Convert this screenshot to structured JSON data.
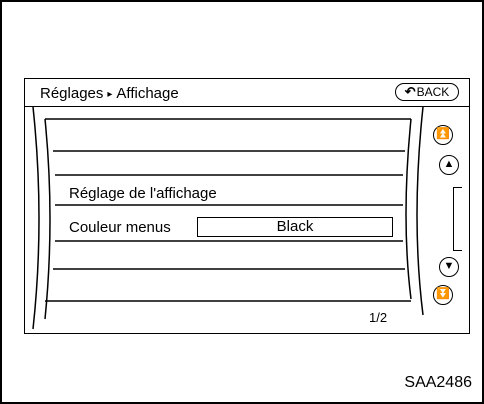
{
  "header": {
    "breadcrumb_parent": "Réglages",
    "breadcrumb_separator": "▸",
    "breadcrumb_current": "Affichage",
    "back_label": "BACK",
    "back_icon": "back-arrow-icon"
  },
  "list": {
    "section_title": "Réglage de l'affichage",
    "rows": [
      {
        "label": "Couleur menus",
        "value": "Black"
      }
    ]
  },
  "pagination": {
    "indicator": "1/2"
  },
  "scroll_icons": [
    "double-chevron-up-icon",
    "chevron-up-icon",
    "chevron-down-icon",
    "double-chevron-down-icon"
  ],
  "figure": {
    "reference_code": "SAA2486"
  }
}
